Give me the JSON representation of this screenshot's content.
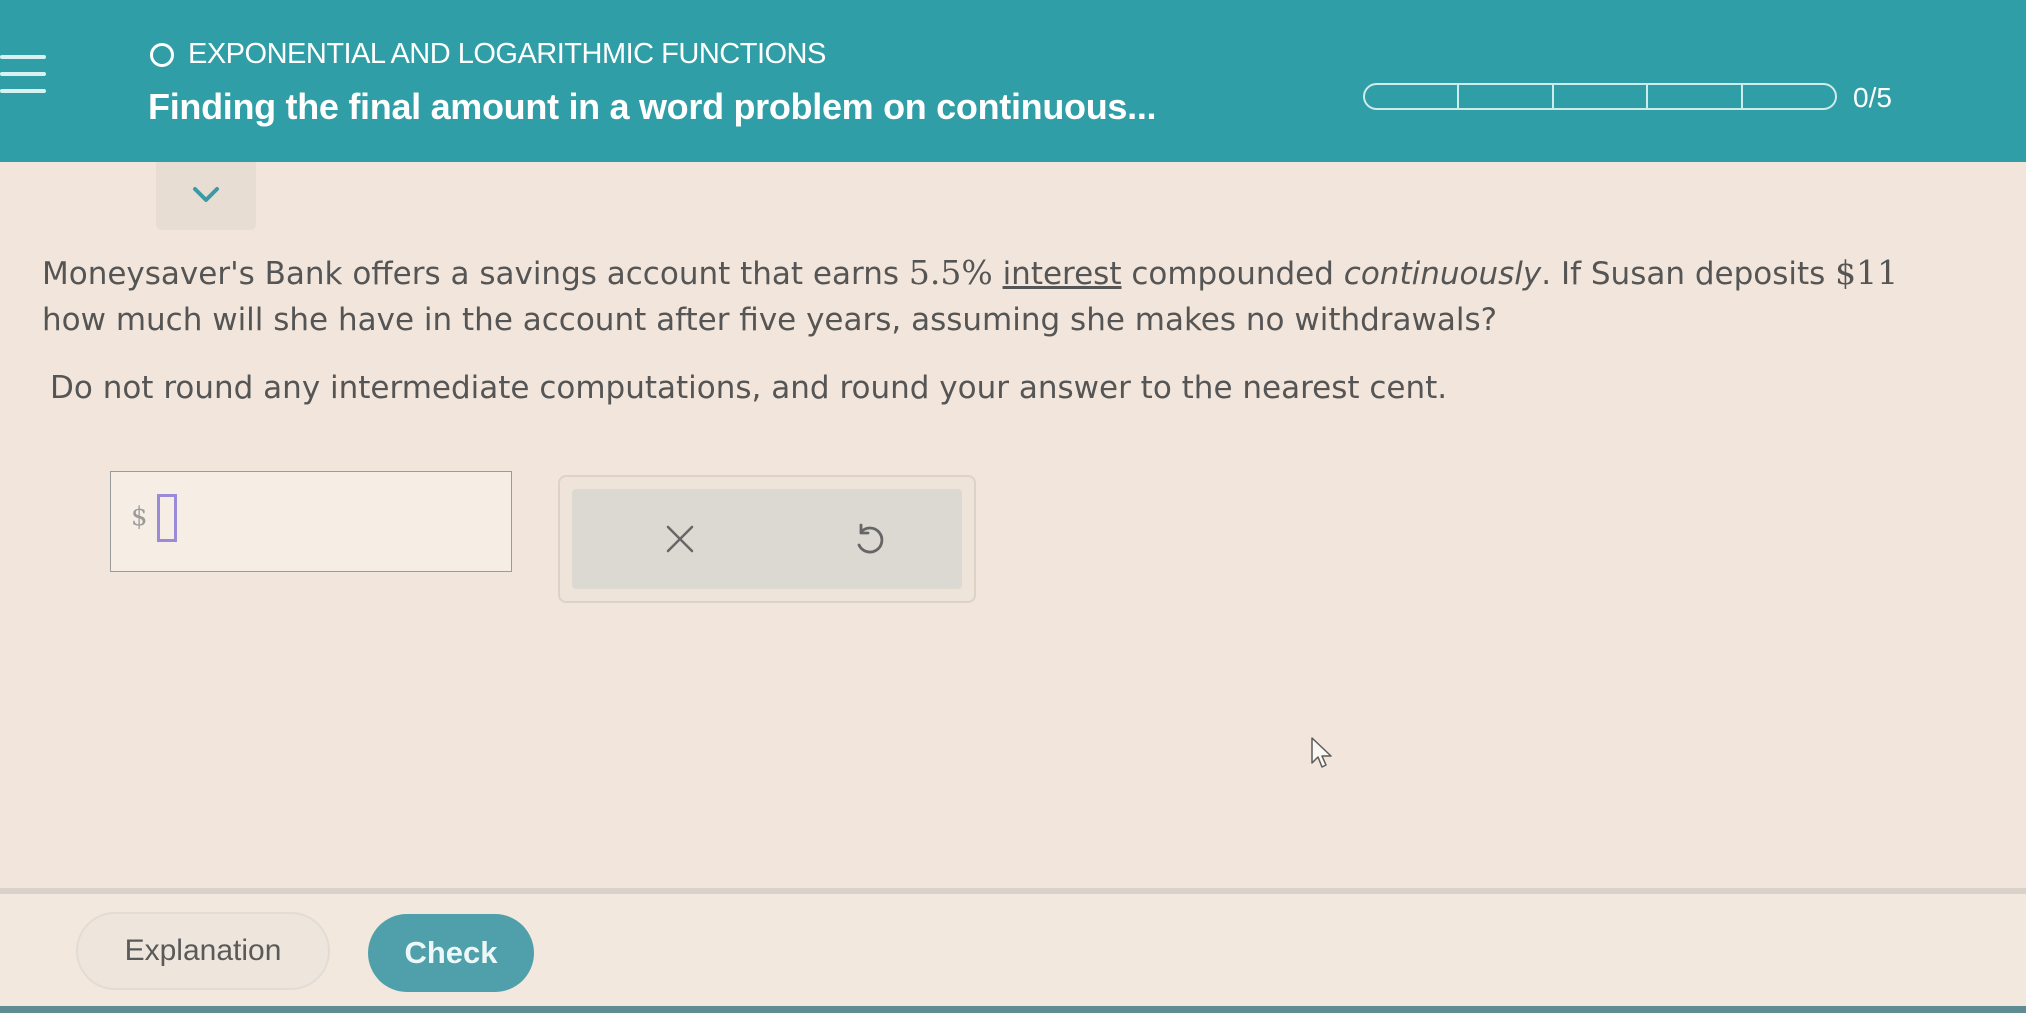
{
  "header": {
    "topic": "EXPONENTIAL AND LOGARITHMIC FUNCTIONS",
    "title": "Finding the final amount in a word problem on continuous...",
    "progress_label": "0/5",
    "progress_fraction": 0
  },
  "question": {
    "part1": "Moneysaver's Bank offers a savings account that earns ",
    "rate": "5.5%",
    "part2": " ",
    "interest_link": "interest",
    "part3": " compounded ",
    "continuously": "continuously",
    "part4": ". If Susan deposits ",
    "deposit_partial": "$11",
    "line2": "how much will she have in the account after five years, assuming she makes no withdrawals?",
    "instruction": "Do not round any intermediate computations, and round your answer to the nearest cent."
  },
  "answer": {
    "currency_symbol": "$",
    "value": ""
  },
  "actions": {
    "clear_icon": "x-icon",
    "undo_icon": "undo-icon"
  },
  "footer": {
    "explanation_label": "Explanation",
    "check_label": "Check"
  },
  "colors": {
    "header": "#2f9ea6",
    "check_button": "#4fa0ab",
    "background": "#f2e6dc",
    "cursor_box": "#9b8ad8"
  }
}
